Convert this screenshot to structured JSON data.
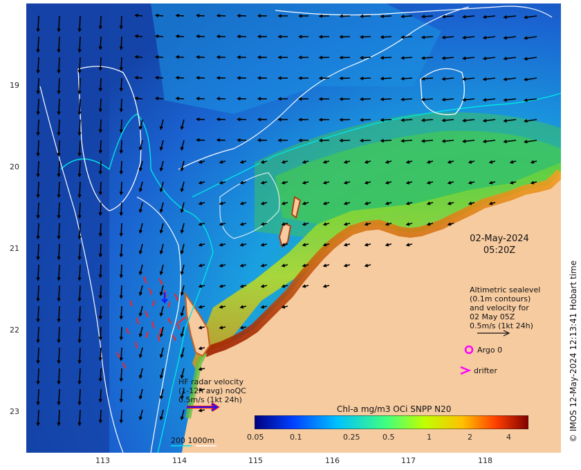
{
  "map": {
    "date_line1": "02-May-2024",
    "date_line2": "05:20Z",
    "altimetry_legend": [
      "Altimetric sealevel",
      "(0.1m contours)",
      "and velocity for",
      "02 May 05Z",
      "0.5m/s (1kt 24h)"
    ],
    "argo_label": "Argo 0",
    "drifter_label": "drifter",
    "hf_radar_legend": [
      "HF radar velocity",
      "(1-12h avg) noQC",
      "0.5m/s (1kt 24h)"
    ],
    "bathy_label": "200  1000m",
    "side_credit": "© IMOS 12-May-2024 12:13:41 Hobart time",
    "colors": {
      "land": "#f7cba0",
      "bathy_200": "#00e5e5",
      "bathy_1000": "#ffffff",
      "argo": "#ff00ff",
      "drifter": "#ff00ff",
      "hf_radar_arrow": "#1a1aff",
      "hf_radar_arrow_outline": "#ff0000"
    }
  },
  "axes": {
    "y_ticks": [
      "19",
      "20",
      "21",
      "22",
      "23"
    ],
    "x_ticks": [
      "113",
      "114",
      "115",
      "116",
      "117",
      "118"
    ]
  },
  "colorbar": {
    "title": "Chl-a mg/m3 OCi SNPP N20",
    "tick_labels": [
      "0.05",
      "0.1",
      "0.25",
      "0.5",
      "1",
      "2",
      "4"
    ],
    "colors": [
      "#00007f",
      "#0040ff",
      "#00c0ff",
      "#40ff80",
      "#c0ff00",
      "#ffc000",
      "#ff4000",
      "#800000"
    ]
  }
}
